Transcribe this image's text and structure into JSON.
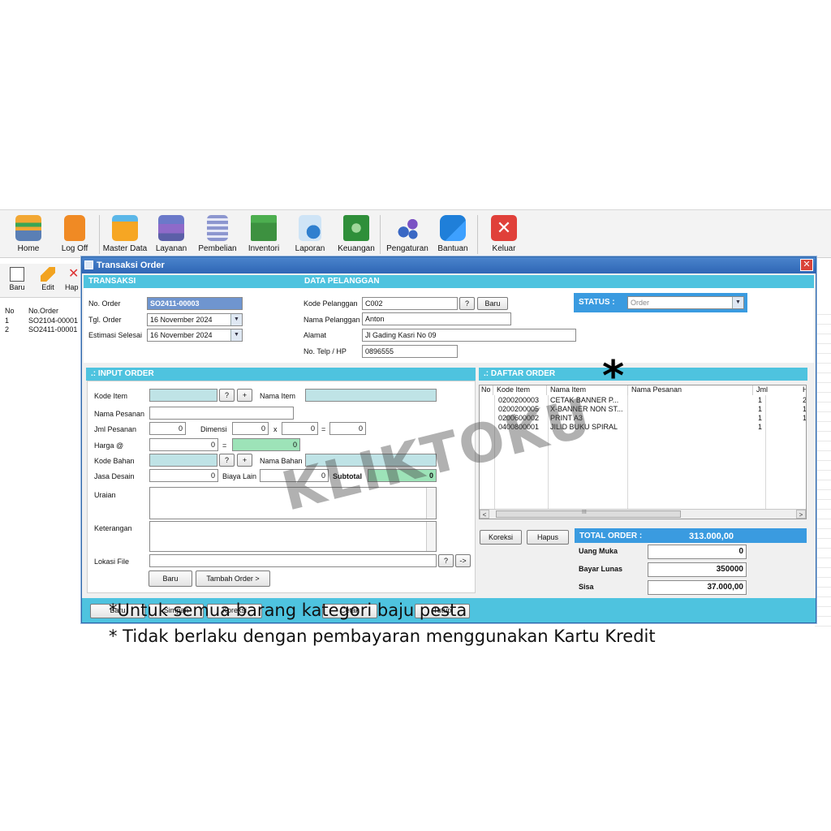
{
  "toolbar": {
    "items": [
      {
        "label": "Home",
        "icon": "store-icon"
      },
      {
        "label": "Log Off",
        "icon": "lock-icon"
      },
      {
        "label": "Master Data",
        "icon": "folder-icon"
      },
      {
        "label": "Layanan",
        "icon": "printer-icon"
      },
      {
        "label": "Pembelian",
        "icon": "document-list-icon"
      },
      {
        "label": "Inventori",
        "icon": "box-icon"
      },
      {
        "label": "Laporan",
        "icon": "report-search-icon"
      },
      {
        "label": "Keuangan",
        "icon": "money-icon"
      },
      {
        "label": "Pengaturan",
        "icon": "gears-icon"
      },
      {
        "label": "Bantuan",
        "icon": "chat-icon"
      },
      {
        "label": "Keluar",
        "icon": "close-icon"
      }
    ]
  },
  "bg_app": {
    "sub_toolbar": {
      "new_label": "Baru",
      "edit_label": "Edit",
      "delete_label": "Hap"
    },
    "list": {
      "headers": [
        "No",
        "No.Order"
      ],
      "rows": [
        [
          "1",
          "SO2104-00001"
        ],
        [
          "2",
          "SO2411-00001"
        ]
      ]
    }
  },
  "dialog": {
    "title": "Transaksi Order",
    "close_glyph": "✕",
    "transaksi": {
      "header": "TRANSAKSI",
      "no_order_label": "No. Order",
      "no_order_value": "SO2411-00003",
      "tgl_order_label": "Tgl. Order",
      "tgl_order_value": "16 November 2024",
      "estimasi_label": "Estimasi Selesai",
      "estimasi_value": "16 November 2024"
    },
    "pelanggan": {
      "header": "DATA PELANGGAN",
      "kode_label": "Kode Pelanggan",
      "kode_value": "C002",
      "help_btn": "?",
      "baru_btn": "Baru",
      "nama_label": "Nama Pelanggan",
      "nama_value": "Anton",
      "alamat_label": "Alamat",
      "alamat_value": "Jl Gading Kasri No 09",
      "telp_label": "No. Telp / HP",
      "telp_value": "0896555"
    },
    "status": {
      "label": "STATUS :",
      "value": "Order"
    },
    "input_order": {
      "header": ".: INPUT ORDER",
      "kode_item_label": "Kode Item",
      "help_btn": "?",
      "plus_btn": "+",
      "nama_item_label": "Nama Item",
      "nama_pesanan_label": "Nama Pesanan",
      "jml_label": "Jml Pesanan",
      "jml_value": "0",
      "dimensi_label": "Dimensi",
      "dim1": "0",
      "times": "x",
      "dim2": "0",
      "equals": "=",
      "dim_result": "0",
      "harga_label": "Harga @",
      "harga_value": "0",
      "harga_result": "0",
      "kode_bahan_label": "Kode Bahan",
      "nama_bahan_label": "Nama Bahan",
      "jasa_label": "Jasa Desain",
      "jasa_value": "0",
      "biaya_label": "Biaya Lain",
      "biaya_value": "0",
      "subtotal_label": "Subtotal",
      "subtotal_value": "0",
      "uraian_label": "Uraian",
      "keterangan_label": "Keterangan",
      "lokasi_label": "Lokasi File",
      "lokasi_help": "?",
      "lokasi_go": "->",
      "baru_btn": "Baru",
      "tambah_btn": "Tambah Order >"
    },
    "daftar_order": {
      "header": ".: DAFTAR ORDER",
      "columns": [
        "No",
        "Kode Item",
        "Nama Item",
        "Nama Pesanan",
        "Jml",
        "H"
      ],
      "rows": [
        {
          "kode": "0200200003",
          "nama": "CETAK BANNER P...",
          "pesanan": "",
          "jml": "1",
          "h": "2"
        },
        {
          "kode": "0200200005",
          "nama": "X-BANNER NON ST...",
          "pesanan": "",
          "jml": "1",
          "h": "1"
        },
        {
          "kode": "0200600002",
          "nama": "PRINT A3",
          "pesanan": "",
          "jml": "1",
          "h": "1"
        },
        {
          "kode": "0400800001",
          "nama": "JILID BUKU SPIRAL",
          "pesanan": "",
          "jml": "1",
          "h": ""
        }
      ],
      "scroll_left": "<",
      "scroll_right": ">",
      "scroll_grip": "III",
      "koreksi_btn": "Koreksi",
      "hapus_btn": "Hapus"
    },
    "totals": {
      "total_label": "TOTAL ORDER :",
      "total_value": "313.000,00",
      "uang_muka_label": "Uang Muka",
      "uang_muka_value": "0",
      "bayar_label": "Bayar Lunas",
      "bayar_value": "350000",
      "sisa_label": "Sisa",
      "sisa_value": "37.000,00"
    },
    "bottom_buttons": [
      "Baru",
      "Simpan",
      "Koreksi",
      "Cetak",
      "Tutup"
    ]
  },
  "overlay": {
    "watermark": "KLIKTOKU",
    "asterisk": "*",
    "note1": "*Untuk semua barang kategori baju pesta",
    "note2": "* Tidak berlaku dengan pembayaran menggunakan Kartu Kredit"
  },
  "colors": {
    "section_header": "#4ec3df",
    "status_header": "#3a9be0",
    "total_header": "#3a9be0",
    "titlebar": "#2f66b5",
    "close": "#d9443a"
  }
}
